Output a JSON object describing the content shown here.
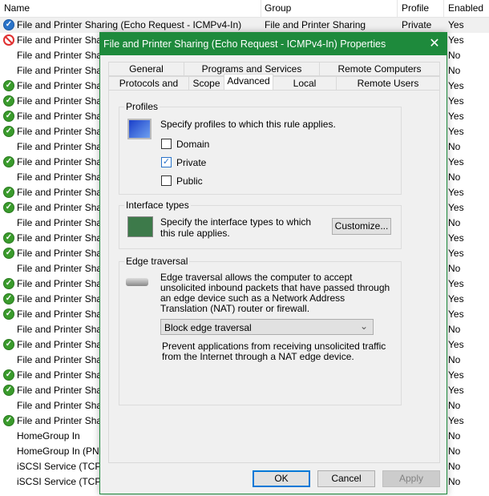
{
  "list": {
    "columns": [
      "Name",
      "Group",
      "Profile",
      "Enabled"
    ],
    "rows": [
      {
        "icon": "enabled-check-blue",
        "name": "File and Printer Sharing (Echo Request - ICMPv4-In)",
        "group": "File and Printer Sharing",
        "profile": "Private",
        "enabled": "Yes"
      },
      {
        "icon": "block",
        "name": "File and Printer Sharing",
        "enabled": "Yes"
      },
      {
        "icon": "none",
        "name": "File and Printer Sharing",
        "enabled": "No"
      },
      {
        "icon": "none",
        "name": "File and Printer Sharing",
        "enabled": "No"
      },
      {
        "icon": "check",
        "name": "File and Printer Sharing",
        "enabled": "Yes"
      },
      {
        "icon": "check",
        "name": "File and Printer Sharing",
        "enabled": "Yes"
      },
      {
        "icon": "check",
        "name": "File and Printer Sharing",
        "enabled": "Yes"
      },
      {
        "icon": "check",
        "name": "File and Printer Sharing",
        "enabled": "Yes"
      },
      {
        "icon": "none",
        "name": "File and Printer Sharing",
        "enabled": "No"
      },
      {
        "icon": "check",
        "name": "File and Printer Sharing",
        "enabled": "Yes"
      },
      {
        "icon": "none",
        "name": "File and Printer Sharing",
        "enabled": "No"
      },
      {
        "icon": "check",
        "name": "File and Printer Sharing",
        "enabled": "Yes"
      },
      {
        "icon": "check",
        "name": "File and Printer Sharing",
        "enabled": "Yes"
      },
      {
        "icon": "none",
        "name": "File and Printer Sharing",
        "enabled": "No"
      },
      {
        "icon": "check",
        "name": "File and Printer Sharing",
        "enabled": "Yes"
      },
      {
        "icon": "check",
        "name": "File and Printer Sharing",
        "enabled": "Yes"
      },
      {
        "icon": "none",
        "name": "File and Printer Sharing",
        "enabled": "No"
      },
      {
        "icon": "check",
        "name": "File and Printer Sharing",
        "enabled": "Yes"
      },
      {
        "icon": "check",
        "name": "File and Printer Sharing",
        "enabled": "Yes"
      },
      {
        "icon": "check",
        "name": "File and Printer Sharing",
        "enabled": "Yes"
      },
      {
        "icon": "none",
        "name": "File and Printer Sharing",
        "enabled": "No"
      },
      {
        "icon": "check",
        "name": "File and Printer Sharing",
        "enabled": "Yes"
      },
      {
        "icon": "none",
        "name": "File and Printer Sharing",
        "enabled": "No"
      },
      {
        "icon": "check",
        "name": "File and Printer Sharing",
        "enabled": "Yes"
      },
      {
        "icon": "check",
        "name": "File and Printer Sharing",
        "enabled": "Yes"
      },
      {
        "icon": "none",
        "name": "File and Printer Sharing",
        "enabled": "No"
      },
      {
        "icon": "check",
        "name": "File and Printer Sharing",
        "enabled": "Yes"
      },
      {
        "icon": "none",
        "name": "HomeGroup In",
        "enabled": "No"
      },
      {
        "icon": "none",
        "name": "HomeGroup In (PNRP)",
        "enabled": "No"
      },
      {
        "icon": "none",
        "name": "iSCSI Service (TCP-In)",
        "enabled": "No"
      },
      {
        "icon": "none",
        "name": "iSCSI Service (TCP-In)",
        "enabled": "No"
      }
    ]
  },
  "dialog": {
    "title": "File and Printer Sharing (Echo Request - ICMPv4-In) Properties",
    "accent": "#1e8a3c",
    "tabs_row1": [
      "General",
      "Programs and Services",
      "Remote Computers"
    ],
    "tabs_row2": [
      "Protocols and Ports",
      "Scope",
      "Advanced",
      "Local Principals",
      "Remote Users"
    ],
    "active_tab": "Advanced",
    "profiles": {
      "legend": "Profiles",
      "desc": "Specify profiles to which this rule applies.",
      "domain": "Domain",
      "private": "Private",
      "public": "Public",
      "domain_checked": false,
      "private_checked": true,
      "public_checked": false
    },
    "interface": {
      "legend": "Interface types",
      "desc": "Specify the interface types to which this rule applies.",
      "button": "Customize..."
    },
    "edge": {
      "legend": "Edge traversal",
      "desc": "Edge traversal allows the computer to accept unsolicited inbound packets that have passed through an edge device such as a Network Address Translation (NAT) router or firewall.",
      "select": "Block edge traversal",
      "note": "Prevent applications from receiving unsolicited traffic from the Internet through a NAT edge device."
    },
    "buttons": {
      "ok": "OK",
      "cancel": "Cancel",
      "apply": "Apply"
    }
  }
}
